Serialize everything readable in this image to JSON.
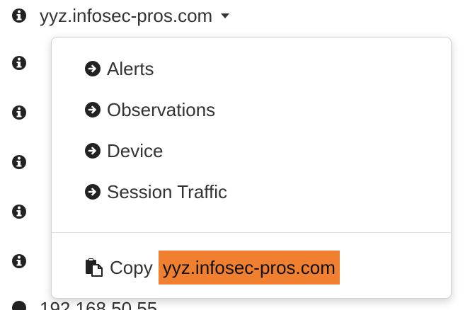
{
  "header": {
    "domain": "yyz.infosec-pros.com"
  },
  "menu": {
    "items": [
      {
        "label": "Alerts",
        "icon": "circle-arrow-right-icon"
      },
      {
        "label": "Observations",
        "icon": "circle-arrow-right-icon"
      },
      {
        "label": "Device",
        "icon": "circle-arrow-right-icon"
      },
      {
        "label": "Session Traffic",
        "icon": "circle-arrow-right-icon"
      }
    ],
    "copy_label": "Copy",
    "copy_value": "yyz.infosec-pros.com",
    "copy_icon": "paste-icon"
  },
  "bottom_row": {
    "text": "192.168.50.55"
  },
  "colors": {
    "highlight": "#f08030",
    "text": "#333333"
  }
}
